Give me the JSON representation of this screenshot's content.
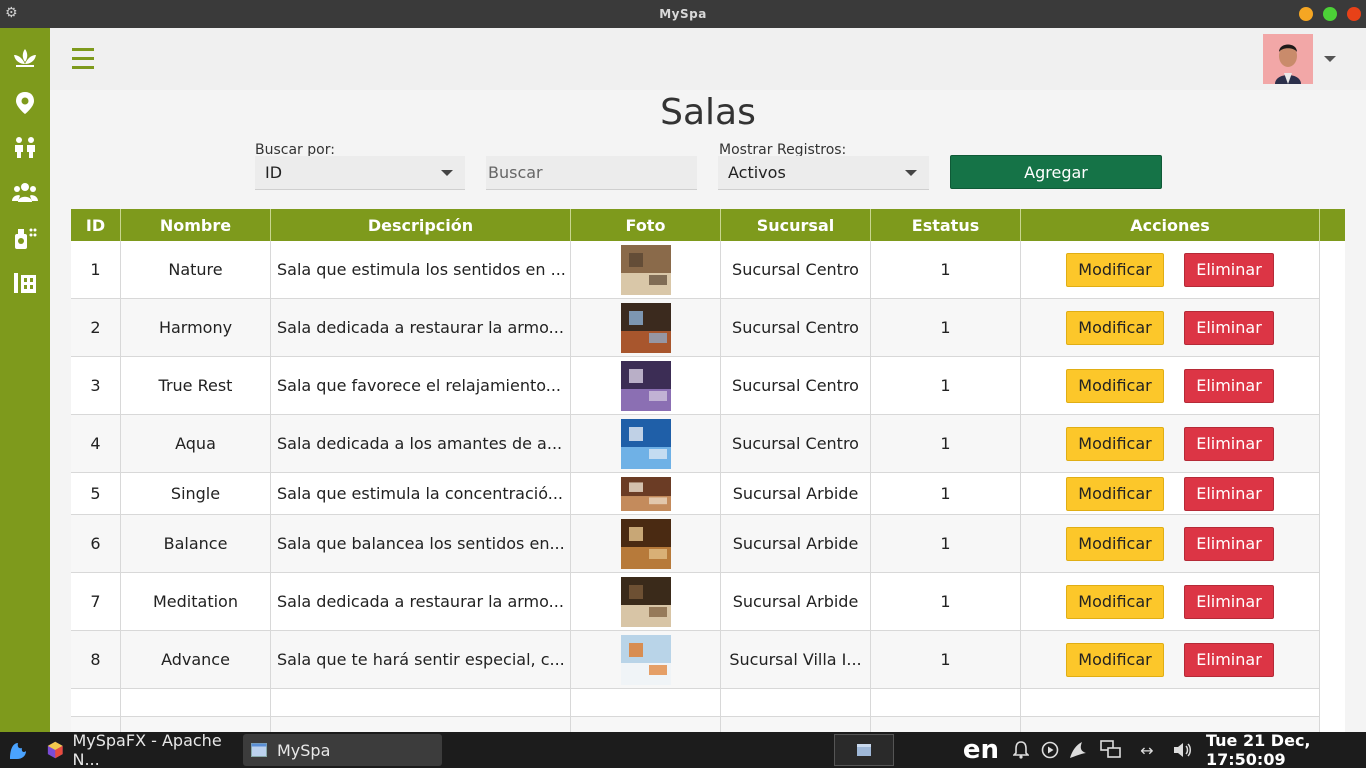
{
  "window": {
    "title": "MySpa"
  },
  "colors": {
    "accent": "#7e9a1c",
    "add": "#157347",
    "modify": "#fcc72a",
    "delete": "#dc3545"
  },
  "sidebar": {
    "items": [
      {
        "icon": "spa-lotus-icon"
      },
      {
        "icon": "location-pin-icon"
      },
      {
        "icon": "people-meeting-icon"
      },
      {
        "icon": "group-icon"
      },
      {
        "icon": "products-icon"
      },
      {
        "icon": "rooms-icon",
        "active": true
      }
    ]
  },
  "page": {
    "title": "Salas"
  },
  "filters": {
    "search_by_label": "Buscar por:",
    "search_by_value": "ID",
    "search_placeholder": "Buscar",
    "show_records_label": "Mostrar Registros:",
    "show_records_value": "Activos",
    "add_label": "Agregar"
  },
  "table": {
    "columns": [
      "ID",
      "Nombre",
      "Descripción",
      "Foto",
      "Sucursal",
      "Estatus",
      "Acciones"
    ],
    "modify_label": "Modificar",
    "delete_label": "Eliminar",
    "rows": [
      {
        "id": "1",
        "name": "Nature",
        "description": "Sala que estimula los sentidos en ...",
        "branch": "Sucursal Centro",
        "status": "1"
      },
      {
        "id": "2",
        "name": "Harmony",
        "description": "Sala dedicada a restaurar la armo...",
        "branch": "Sucursal Centro",
        "status": "1"
      },
      {
        "id": "3",
        "name": "True Rest",
        "description": "Sala que favorece el relajamiento...",
        "branch": "Sucursal Centro",
        "status": "1"
      },
      {
        "id": "4",
        "name": "Aqua",
        "description": "Sala dedicada a los amantes de a...",
        "branch": "Sucursal Centro",
        "status": "1"
      },
      {
        "id": "5",
        "name": "Single",
        "description": "Sala que estimula la concentració...",
        "branch": "Sucursal Arbide",
        "status": "1"
      },
      {
        "id": "6",
        "name": "Balance",
        "description": "Sala que balancea los sentidos en...",
        "branch": "Sucursal Arbide",
        "status": "1"
      },
      {
        "id": "7",
        "name": "Meditation",
        "description": "Sala dedicada a restaurar la armo...",
        "branch": "Sucursal Arbide",
        "status": "1"
      },
      {
        "id": "8",
        "name": "Advance",
        "description": "Sala que te hará sentir especial, c...",
        "branch": "Sucursal Villa I...",
        "status": "1"
      }
    ]
  },
  "taskbar": {
    "tasks": [
      {
        "label": "MySpaFX - Apache N..."
      },
      {
        "label": "MySpa"
      }
    ],
    "lang": "en",
    "clock": "Tue 21 Dec, 17:50:09"
  }
}
